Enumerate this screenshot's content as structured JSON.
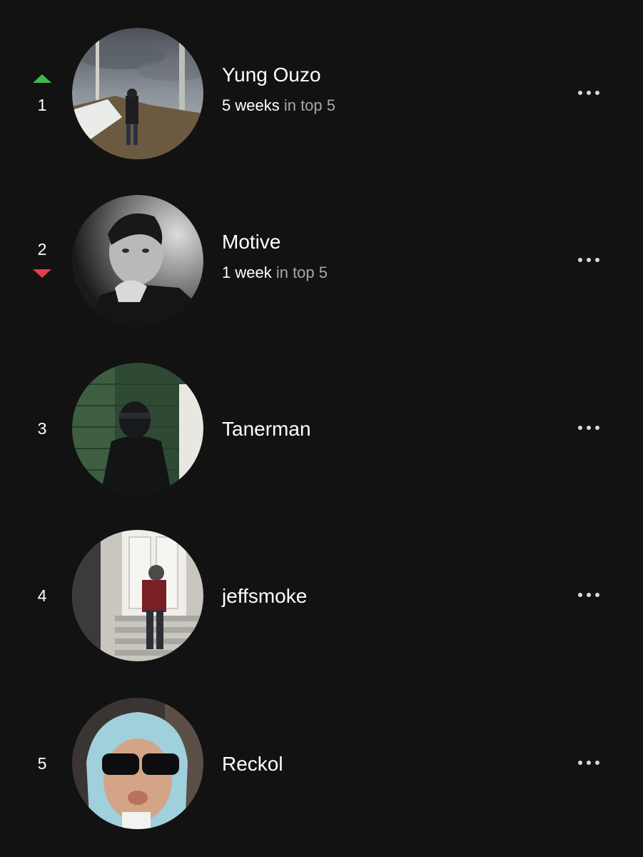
{
  "colors": {
    "background": "#121212",
    "trend_up": "#3fb950",
    "trend_down": "#e0404c",
    "text_primary": "#ffffff",
    "text_secondary": "#a7a7a7"
  },
  "artists": [
    {
      "rank": "1",
      "trend": "up",
      "name": "Yung Ouzo",
      "weeks_count": "5 weeks",
      "weeks_suffix": " in top 5",
      "more_icon": "more-horizontal-icon"
    },
    {
      "rank": "2",
      "trend": "down",
      "name": "Motive",
      "weeks_count": "1 week",
      "weeks_suffix": " in top 5",
      "more_icon": "more-horizontal-icon"
    },
    {
      "rank": "3",
      "trend": "none",
      "name": "Tanerman",
      "more_icon": "more-horizontal-icon"
    },
    {
      "rank": "4",
      "trend": "none",
      "name": "jeffsmoke",
      "more_icon": "more-horizontal-icon"
    },
    {
      "rank": "5",
      "trend": "none",
      "name": "Reckol",
      "more_icon": "more-horizontal-icon"
    }
  ]
}
